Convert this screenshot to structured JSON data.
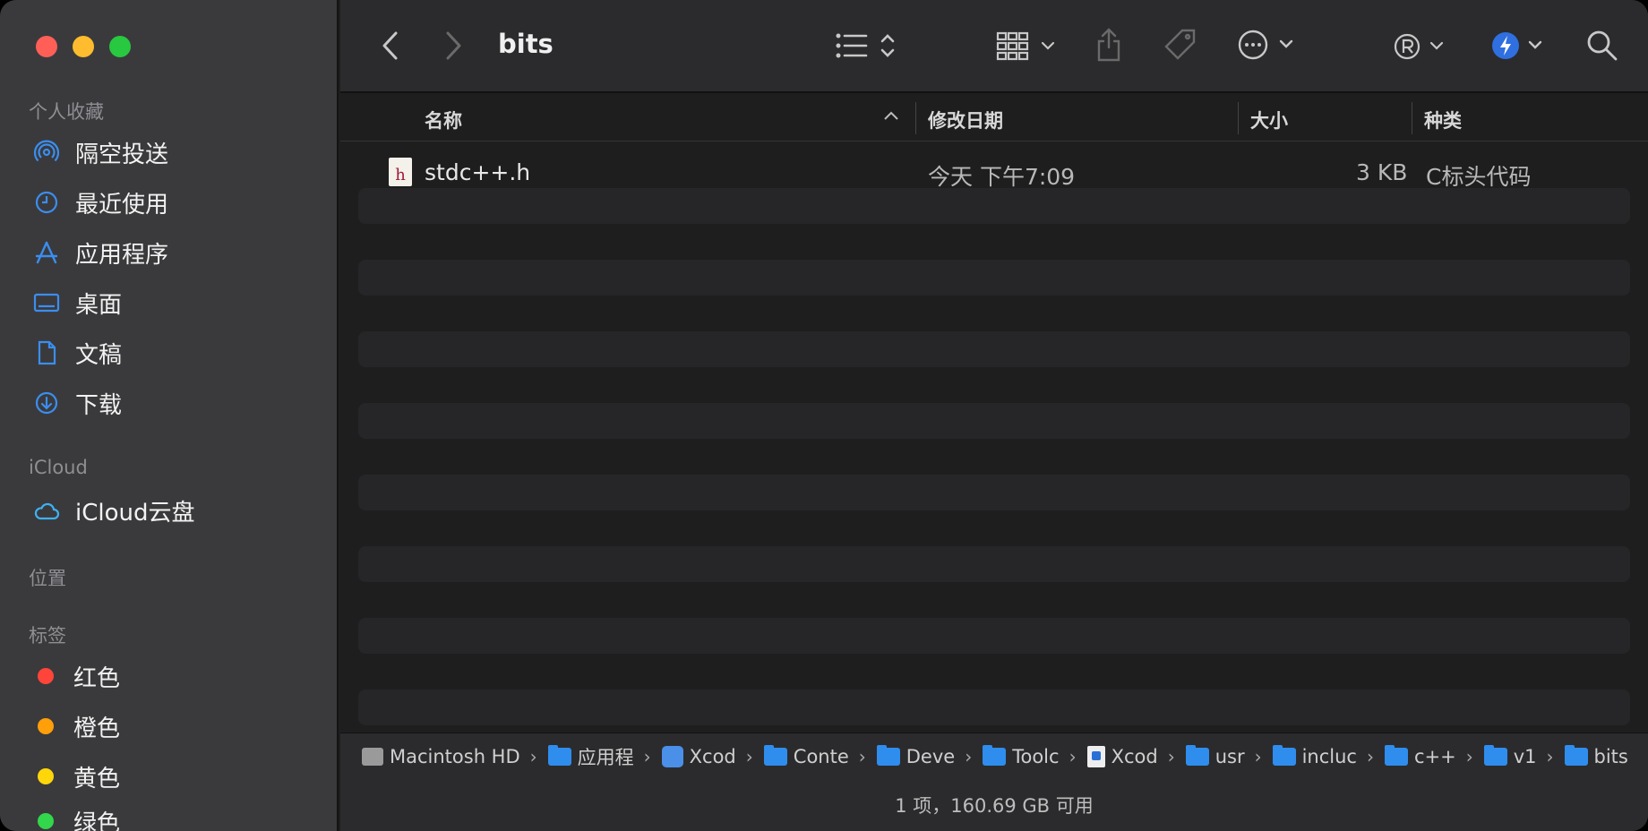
{
  "window": {
    "title": "bits"
  },
  "sidebar": {
    "favorites_header": "个人收藏",
    "favorites": [
      {
        "label": "隔空投送",
        "icon": "airdrop-icon"
      },
      {
        "label": "最近使用",
        "icon": "clock-icon"
      },
      {
        "label": "应用程序",
        "icon": "applications-icon"
      },
      {
        "label": "桌面",
        "icon": "desktop-icon"
      },
      {
        "label": "文稿",
        "icon": "document-icon"
      },
      {
        "label": "下载",
        "icon": "download-icon"
      }
    ],
    "icloud_header": "iCloud",
    "icloud_items": [
      {
        "label": "iCloud云盘",
        "icon": "cloud-icon"
      }
    ],
    "locations_header": "位置",
    "tags_header": "标签",
    "tags": [
      {
        "label": "红色",
        "color": "#ff453a"
      },
      {
        "label": "橙色",
        "color": "#ff9f0a"
      },
      {
        "label": "黄色",
        "color": "#ffd60a"
      },
      {
        "label": "绿色",
        "color": "#32d74b"
      }
    ]
  },
  "columns": {
    "name": "名称",
    "modified": "修改日期",
    "size": "大小",
    "kind": "种类"
  },
  "files": [
    {
      "name": "stdc++.h",
      "modified": "今天 下午7:09",
      "size": "3 KB",
      "kind": "C标头代码"
    }
  ],
  "pathbar": [
    {
      "label": "Macintosh HD",
      "icon": "hd"
    },
    {
      "label": "应用程",
      "icon": "app"
    },
    {
      "label": "Xcod",
      "icon": "xcode"
    },
    {
      "label": "Conte",
      "icon": "folder"
    },
    {
      "label": "Deve",
      "icon": "folder"
    },
    {
      "label": "Toolc",
      "icon": "folder"
    },
    {
      "label": "Xcod",
      "icon": "doc"
    },
    {
      "label": "usr",
      "icon": "folder"
    },
    {
      "label": "incluc",
      "icon": "folder"
    },
    {
      "label": "c++",
      "icon": "folder"
    },
    {
      "label": "v1",
      "icon": "folder"
    },
    {
      "label": "bits",
      "icon": "folder"
    }
  ],
  "status": "1 项，160.69 GB 可用"
}
